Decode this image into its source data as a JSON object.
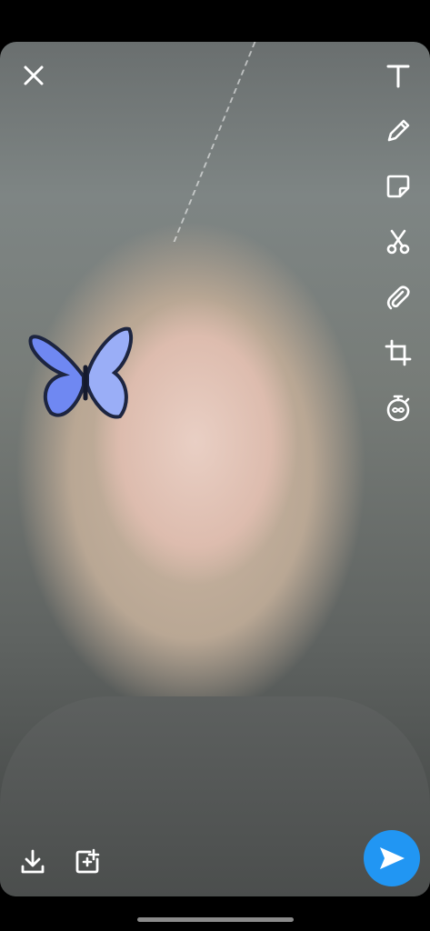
{
  "screen": {
    "mode": "snap-preview-editor",
    "photo": "selfie-with-butterfly-lens"
  },
  "top_left": {
    "icon": "close-icon"
  },
  "toolbar": {
    "tools": [
      {
        "name": "text-tool",
        "icon": "text-icon"
      },
      {
        "name": "draw-tool",
        "icon": "pencil-icon"
      },
      {
        "name": "sticker-tool",
        "icon": "sticker-icon"
      },
      {
        "name": "scissors-tool",
        "icon": "scissors-icon"
      },
      {
        "name": "attach-link-tool",
        "icon": "paperclip-icon"
      },
      {
        "name": "crop-tool",
        "icon": "crop-icon"
      },
      {
        "name": "timer-tool",
        "icon": "timer-infinity-icon"
      }
    ]
  },
  "bottom_bar": {
    "save_icon": "download-icon",
    "story_icon": "add-to-story-icon",
    "send_icon": "send-arrow-icon"
  },
  "colors": {
    "send_button": "#2196f3",
    "icon": "#ffffff",
    "butterfly": "#6f88f2"
  }
}
